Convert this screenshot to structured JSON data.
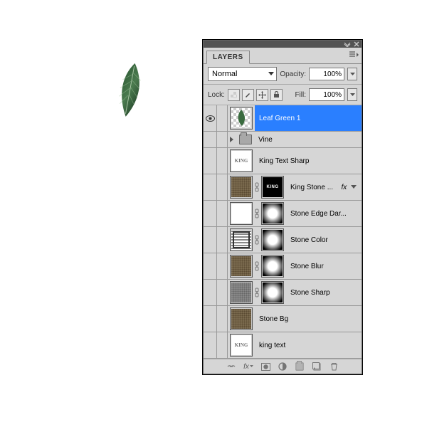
{
  "panel": {
    "tab": "LAYERS",
    "blend_mode": "Normal",
    "opacity_label": "Opacity:",
    "opacity_value": "100%",
    "lock_label": "Lock:",
    "fill_label": "Fill:",
    "fill_value": "100%"
  },
  "layers": [
    {
      "name": "Leaf Green 1",
      "visible": true,
      "selected": true,
      "style": "checker-leaf"
    },
    {
      "name": "Vine",
      "visible": false,
      "group": true
    },
    {
      "name": "King Text Sharp",
      "visible": false,
      "style": "king-text"
    },
    {
      "name": "King Stone ...",
      "visible": false,
      "style": "king-stone",
      "mask": "king-dark",
      "fx": true
    },
    {
      "name": "Stone Edge Dar...",
      "visible": false,
      "style": "grad-h",
      "mask": "radial"
    },
    {
      "name": "Stone Color",
      "visible": false,
      "style": "stripes",
      "mask": "radial"
    },
    {
      "name": "Stone Blur",
      "visible": false,
      "style": "noise",
      "mask": "radial"
    },
    {
      "name": "Stone Sharp",
      "visible": false,
      "style": "grey-noise",
      "mask": "radial"
    },
    {
      "name": "Stone Bg",
      "visible": false,
      "style": "noise"
    },
    {
      "name": "king text",
      "visible": false,
      "style": "king-text"
    }
  ]
}
